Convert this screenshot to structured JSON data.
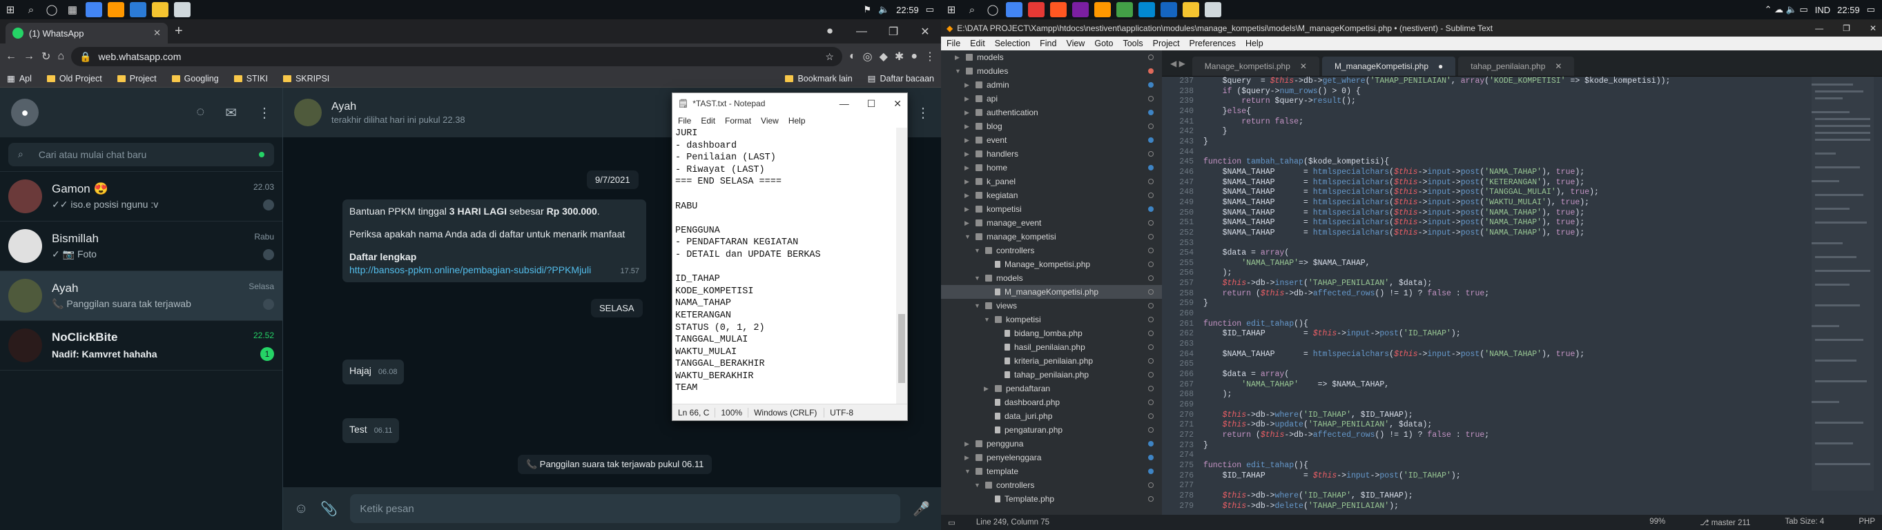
{
  "taskbar_left": {
    "time": "22:59"
  },
  "taskbar_right": {
    "time": "22:59",
    "lang": "IND"
  },
  "chrome": {
    "tab_title": "(1) WhatsApp",
    "url": "web.whatsapp.com",
    "bookmarks": [
      "Apl",
      "Old Project",
      "Project",
      "Googling",
      "STIKI",
      "SKRIPSI",
      "Bookmark lain",
      "Daftar bacaan"
    ]
  },
  "whatsapp": {
    "search_placeholder": "Cari atau mulai chat baru",
    "chats": [
      {
        "name": "Gamon 😍",
        "time": "22.03",
        "preview": "✓✓ iso.e posisi ngunu :v",
        "color": "#6b3a3a"
      },
      {
        "name": "Bismillah",
        "time": "Rabu",
        "preview": "✓ 📷 Foto",
        "color": "#e0e0e0"
      },
      {
        "name": "Ayah",
        "time": "Selasa",
        "preview": "📞 Panggilan suara tak terjawab",
        "color": "#4f5a3c"
      },
      {
        "name": "NoClickBite",
        "time": "22.52",
        "preview": "Nadif: Kamvret hahaha",
        "badge": "1",
        "color": "#2a1b1b"
      }
    ],
    "contact_name": "Ayah",
    "contact_status": "terakhir dilihat hari ini pukul 22.38",
    "date_chip": "9/7/2021",
    "msg1_text_a": "Bantuan PPKM tinggal ",
    "msg1_bold": "3 HARI LAGI",
    "msg1_text_b": " sebesar ",
    "msg1_amount": "Rp 300.000",
    "msg1_line2": "Periksa apakah nama Anda ada di daftar untuk menarik manfaat",
    "msg1_heading": "Daftar lengkap",
    "msg1_link": "http://bansos-ppkm.online/pembagian-subsidi/?PPKMjuli",
    "msg1_time": "17.57",
    "day_chip": "SELASA",
    "msg2_text": "Hajaj",
    "msg2_time": "06.08",
    "msg3_text": "Test",
    "msg3_time": "06.11",
    "missed_call": "📞 Panggilan suara tak terjawab pukul 06.11",
    "input_placeholder": "Ketik pesan"
  },
  "notepad": {
    "title": "*TAST.txt - Notepad",
    "menu": [
      "File",
      "Edit",
      "Format",
      "View",
      "Help"
    ],
    "text": "JURI\n- dashboard\n- Penilaian (LAST)\n- Riwayat (LAST)\n=== END SELASA ====\n\nRABU\n\nPENGGUNA\n- PENDAFTARAN KEGIATAN\n- DETAIL dan UPDATE BERKAS\n\nID_TAHAP\nKODE_KOMPETISI\nNAMA_TAHAP\nKETERANGAN\nSTATUS (0, 1, 2)\nTANGGAL_MULAI\nWAKTU_MULAI\nTANGGAL_BERAKHIR\nWAKTU_BERAKHIR\nTEAM",
    "status": [
      "Ln 66, C",
      "100%",
      "Windows (CRLF)",
      "UTF-8"
    ]
  },
  "sublime": {
    "title": "E:\\DATA PROJECT\\Xampp\\htdocs\\nestivent\\application\\modules\\manage_kompetisi\\models\\M_manageKompetisi.php • (nestivent) - Sublime Text",
    "menu": [
      "File",
      "Edit",
      "Selection",
      "Find",
      "View",
      "Goto",
      "Tools",
      "Project",
      "Preferences",
      "Help"
    ],
    "tabs": [
      "Manage_kompetisi.php",
      "M_manageKompetisi.php",
      "tahap_penilaian.php"
    ],
    "tree": [
      {
        "label": "models",
        "depth": 1,
        "type": "folder",
        "mark": "hollow"
      },
      {
        "label": "modules",
        "depth": 1,
        "type": "folder-open",
        "mark": "red"
      },
      {
        "label": "admin",
        "depth": 2,
        "type": "folder",
        "mark": "blue"
      },
      {
        "label": "api",
        "depth": 2,
        "type": "folder",
        "mark": "hollow"
      },
      {
        "label": "authentication",
        "depth": 2,
        "type": "folder",
        "mark": "blue"
      },
      {
        "label": "blog",
        "depth": 2,
        "type": "folder",
        "mark": "hollow"
      },
      {
        "label": "event",
        "depth": 2,
        "type": "folder",
        "mark": "blue"
      },
      {
        "label": "handlers",
        "depth": 2,
        "type": "folder",
        "mark": "hollow"
      },
      {
        "label": "home",
        "depth": 2,
        "type": "folder",
        "mark": "blue"
      },
      {
        "label": "k_panel",
        "depth": 2,
        "type": "folder",
        "mark": "hollow"
      },
      {
        "label": "kegiatan",
        "depth": 2,
        "type": "folder",
        "mark": "hollow"
      },
      {
        "label": "kompetisi",
        "depth": 2,
        "type": "folder",
        "mark": "blue"
      },
      {
        "label": "manage_event",
        "depth": 2,
        "type": "folder",
        "mark": "hollow"
      },
      {
        "label": "manage_kompetisi",
        "depth": 2,
        "type": "folder-open",
        "mark": "hollow"
      },
      {
        "label": "controllers",
        "depth": 3,
        "type": "folder-open",
        "mark": "hollow"
      },
      {
        "label": "Manage_kompetisi.php",
        "depth": 4,
        "type": "file",
        "mark": "hollow"
      },
      {
        "label": "models",
        "depth": 3,
        "type": "folder-open",
        "mark": "hollow"
      },
      {
        "label": "M_manageKompetisi.php",
        "depth": 4,
        "type": "file",
        "mark": "hollow",
        "selected": true
      },
      {
        "label": "views",
        "depth": 3,
        "type": "folder-open",
        "mark": "hollow"
      },
      {
        "label": "kompetisi",
        "depth": 4,
        "type": "folder-open",
        "mark": "hollow"
      },
      {
        "label": "bidang_lomba.php",
        "depth": 5,
        "type": "file",
        "mark": "hollow"
      },
      {
        "label": "hasil_penilaian.php",
        "depth": 5,
        "type": "file",
        "mark": "hollow"
      },
      {
        "label": "kriteria_penilaian.php",
        "depth": 5,
        "type": "file",
        "mark": "hollow"
      },
      {
        "label": "tahap_penilaian.php",
        "depth": 5,
        "type": "file",
        "mark": "hollow"
      },
      {
        "label": "pendaftaran",
        "depth": 4,
        "type": "folder",
        "mark": "hollow"
      },
      {
        "label": "dashboard.php",
        "depth": 4,
        "type": "file",
        "mark": "hollow"
      },
      {
        "label": "data_juri.php",
        "depth": 4,
        "type": "file",
        "mark": "hollow"
      },
      {
        "label": "pengaturan.php",
        "depth": 4,
        "type": "file",
        "mark": "hollow"
      },
      {
        "label": "pengguna",
        "depth": 2,
        "type": "folder",
        "mark": "blue"
      },
      {
        "label": "penyelenggara",
        "depth": 2,
        "type": "folder",
        "mark": "blue"
      },
      {
        "label": "template",
        "depth": 2,
        "type": "folder-open",
        "mark": "blue"
      },
      {
        "label": "controllers",
        "depth": 3,
        "type": "folder-open",
        "mark": "hollow"
      },
      {
        "label": "Template.php",
        "depth": 4,
        "type": "file",
        "mark": "hollow"
      }
    ],
    "line_start": 237,
    "code": [
      "    $query  = $this->db->get_where('TAHAP_PENILAIAN', array('KODE_KOMPETISI' => $kode_kompetisi));",
      "    if ($query->num_rows() > 0) {",
      "        return $query->result();",
      "    }else{",
      "        return false;",
      "    }",
      "}",
      "",
      "function tambah_tahap($kode_kompetisi){",
      "    $NAMA_TAHAP      = htmlspecialchars($this->input->post('NAMA_TAHAP'), true);",
      "    $NAMA_TAHAP      = htmlspecialchars($this->input->post('KETERANGAN'), true);",
      "    $NAMA_TAHAP      = htmlspecialchars($this->input->post('TANGGAL_MULAI'), true);",
      "    $NAMA_TAHAP      = htmlspecialchars($this->input->post('WAKTU_MULAI'), true);",
      "    $NAMA_TAHAP      = htmlspecialchars($this->input->post('NAMA_TAHAP'), true);",
      "    $NAMA_TAHAP      = htmlspecialchars($this->input->post('NAMA_TAHAP'), true);",
      "    $NAMA_TAHAP      = htmlspecialchars($this->input->post('NAMA_TAHAP'), true);",
      "",
      "    $data = array(",
      "        'NAMA_TAHAP'=> $NAMA_TAHAP,",
      "    );",
      "    $this->db->insert('TAHAP_PENILAIAN', $data);",
      "    return ($this->db->affected_rows() != 1) ? false : true;",
      "}",
      "",
      "function edit_tahap(){",
      "    $ID_TAHAP        = $this->input->post('ID_TAHAP');",
      "",
      "    $NAMA_TAHAP      = htmlspecialchars($this->input->post('NAMA_TAHAP'), true);",
      "",
      "    $data = array(",
      "        'NAMA_TAHAP'    => $NAMA_TAHAP,",
      "    );",
      "",
      "    $this->db->where('ID_TAHAP', $ID_TAHAP);",
      "    $this->db->update('TAHAP_PENILAIAN', $data);",
      "    return ($this->db->affected_rows() != 1) ? false : true;",
      "}",
      "",
      "function edit_tahap(){",
      "    $ID_TAHAP        = $this->input->post('ID_TAHAP');",
      "",
      "    $this->db->where('ID_TAHAP', $ID_TAHAP);",
      "    $this->db->delete('TAHAP_PENILAIAN');"
    ],
    "status_left": "Line 249, Column 75",
    "status_zoom": "99%",
    "status_branch": "master",
    "status_branch_count": "211",
    "status_tab": "Tab Size: 4",
    "status_lang": "PHP"
  }
}
